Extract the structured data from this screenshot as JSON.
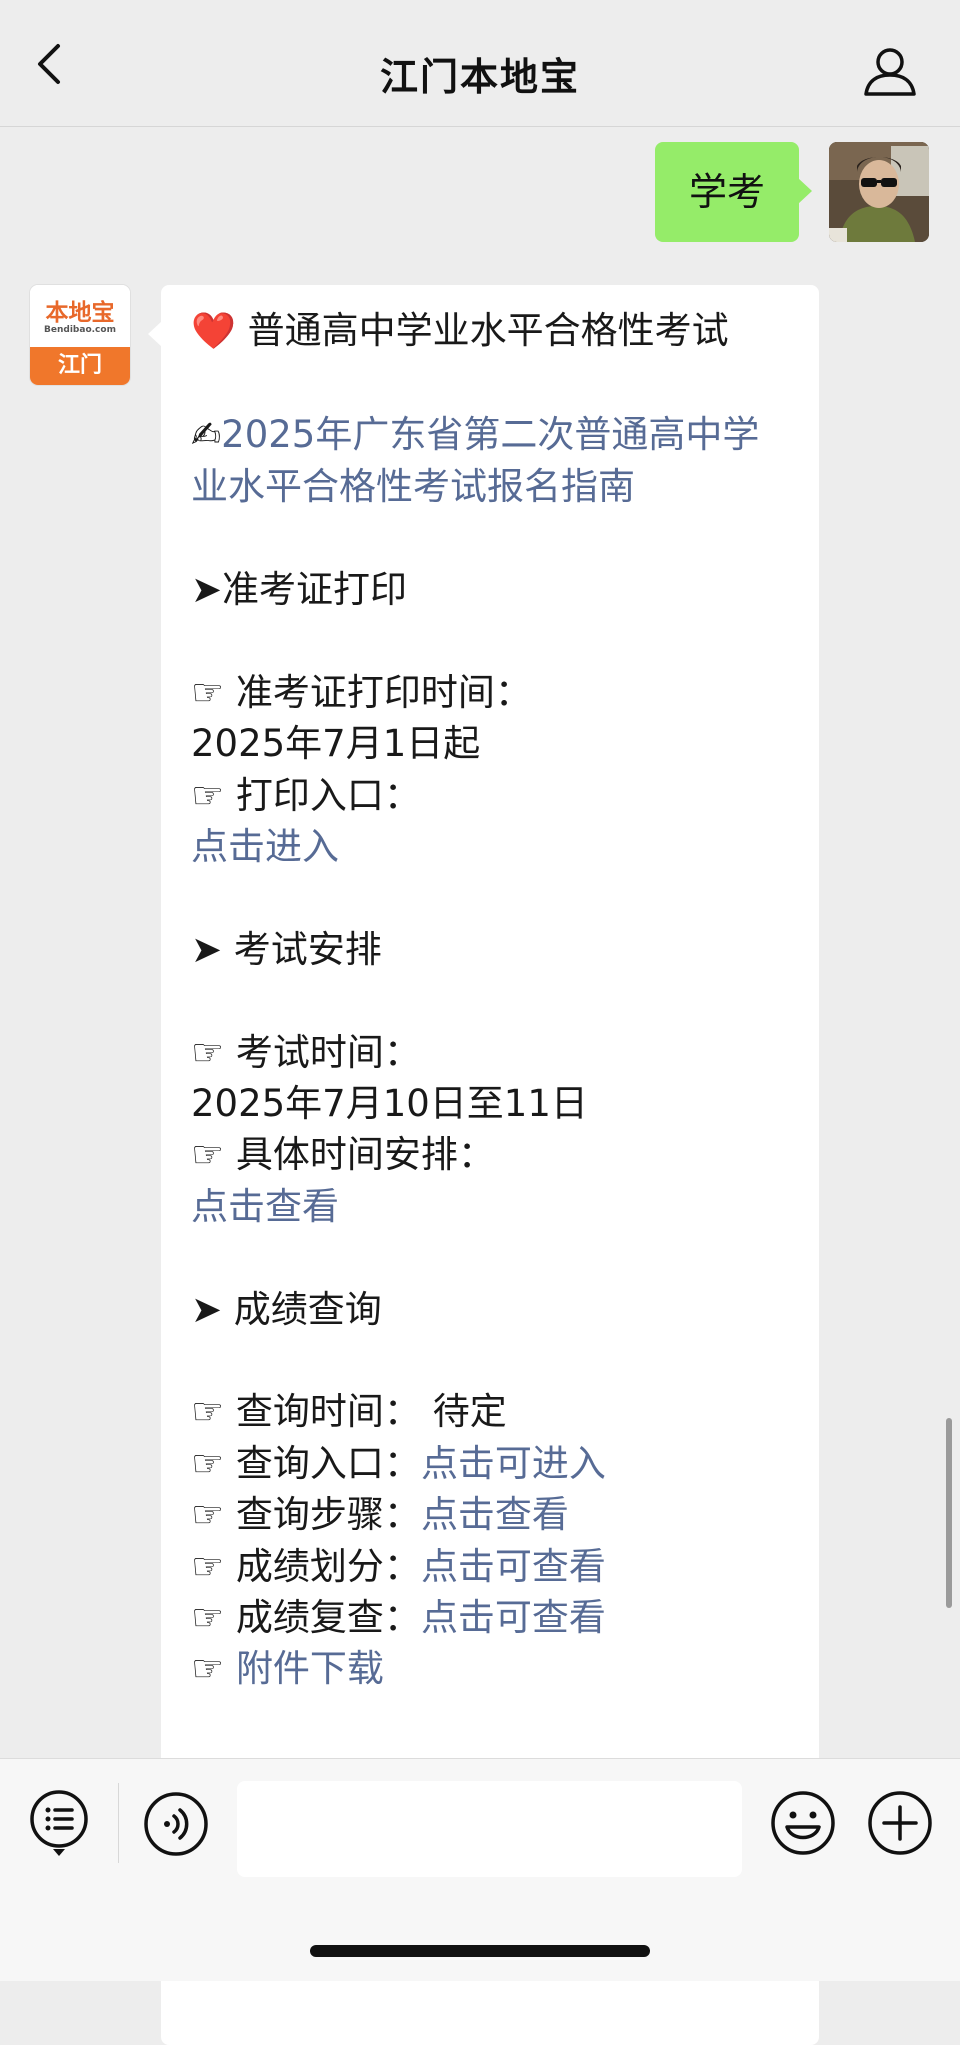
{
  "header": {
    "title": "江门本地宝"
  },
  "chat": {
    "outgoing": {
      "text": "学考"
    },
    "incoming": {
      "sender_logo_text": "本地宝",
      "sender_logo_url": "Bendibao.com",
      "sender_logo_city": "江门",
      "heading_emoji": "❤️",
      "heading": "普通高中学业水平合格性考试",
      "guide_emoji": "✍",
      "guide_link": "2025年广东省第二次普通高中学业水平合格性考试报名指南",
      "section1": {
        "title": "➤准考证打印",
        "print_time_label": "☞ 准考证打印时间：",
        "print_time_value": "2025年7月1日起",
        "entry_label": "☞ 打印入口：",
        "entry_link": "点击进入"
      },
      "section2": {
        "title": "➤ 考试安排",
        "exam_time_label": "☞ 考试时间：",
        "exam_time_value": "2025年7月10日至11日",
        "schedule_label": "☞ 具体时间安排：",
        "schedule_link": "点击查看"
      },
      "section3": {
        "title": "➤ 成绩查询",
        "items": [
          {
            "label": "☞ 查询时间：",
            "value": " 待定",
            "is_link": false
          },
          {
            "label": "☞ 查询入口：",
            "value": "点击可进入",
            "is_link": true
          },
          {
            "label": "☞ 查询步骤：",
            "value": "点击查看",
            "is_link": true
          },
          {
            "label": "☞ 成绩划分：",
            "value": "点击可查看",
            "is_link": true
          },
          {
            "label": "☞ 成绩复查：",
            "value": "点击可查看",
            "is_link": true
          },
          {
            "label": "☞ ",
            "value": "附件下载",
            "is_link": true
          }
        ]
      }
    }
  },
  "input": {
    "placeholder": ""
  },
  "colors": {
    "outgoing_bubble": "#95ec69",
    "link": "#576b95",
    "background": "#ededed",
    "logo_orange": "#f0772b"
  },
  "icons": [
    "back-icon",
    "user-profile-icon",
    "menu-list-icon",
    "voice-icon",
    "emoji-icon",
    "plus-icon"
  ]
}
